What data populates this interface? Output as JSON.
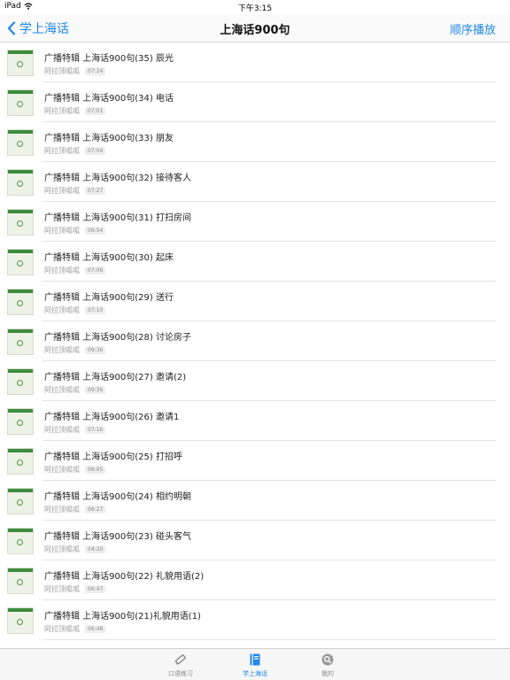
{
  "status_bar": {
    "device": "iPad",
    "time": "下午3:15"
  },
  "nav": {
    "back_label": "学上海话",
    "title": "上海话900句",
    "right_label": "顺序播放"
  },
  "list": [
    {
      "title": "广播特辑 上海话900句(35) 辰光",
      "author": "阿拉顶呱呱",
      "duration": "07:24"
    },
    {
      "title": "广播特辑 上海话900句(34) 电话",
      "author": "阿拉顶呱呱",
      "duration": "07:01"
    },
    {
      "title": "广播特辑 上海话900句(33) 朋友",
      "author": "阿拉顶呱呱",
      "duration": "07:04"
    },
    {
      "title": "广播特辑 上海话900句(32) 接待客人",
      "author": "阿拉顶呱呱",
      "duration": "07:27"
    },
    {
      "title": "广播特辑 上海话900句(31) 打扫房间",
      "author": "阿拉顶呱呱",
      "duration": "09:54"
    },
    {
      "title": "广播特辑 上海话900句(30) 起床",
      "author": "阿拉顶呱呱",
      "duration": "07:06"
    },
    {
      "title": "广播特辑 上海话900句(29) 送行",
      "author": "阿拉顶呱呱",
      "duration": "07:10"
    },
    {
      "title": "广播特辑 上海话900句(28) 讨论房子",
      "author": "阿拉顶呱呱",
      "duration": "09:36"
    },
    {
      "title": "广播特辑 上海话900句(27) 邀请(2)",
      "author": "阿拉顶呱呱",
      "duration": "09:36"
    },
    {
      "title": "广播特辑 上海话900句(26) 邀请1",
      "author": "阿拉顶呱呱",
      "duration": "07:16"
    },
    {
      "title": "广播特辑 上海话900句(25) 打招呼",
      "author": "阿拉顶呱呱",
      "duration": "06:05"
    },
    {
      "title": "广播特辑 上海话900句(24) 相约明朝",
      "author": "阿拉顶呱呱",
      "duration": "06:27"
    },
    {
      "title": "广播特辑 上海话900句(23) 碰头客气",
      "author": "阿拉顶呱呱",
      "duration": "04:20"
    },
    {
      "title": "广播特辑 上海话900句(22) 礼貌用语(2)",
      "author": "阿拉顶呱呱",
      "duration": "06:47"
    },
    {
      "title": "广播特辑 上海话900句(21)礼貌用语(1)",
      "author": "阿拉顶呱呱",
      "duration": "06:48"
    }
  ],
  "tabs": [
    {
      "label": "口语练习",
      "icon": "pencil-icon",
      "active": false
    },
    {
      "label": "学上海话",
      "icon": "book-icon",
      "active": true
    },
    {
      "label": "我的",
      "icon": "profile-icon",
      "active": false
    }
  ],
  "colors": {
    "accent": "#1e88e5",
    "thumb_green": "#3d8b3d"
  }
}
